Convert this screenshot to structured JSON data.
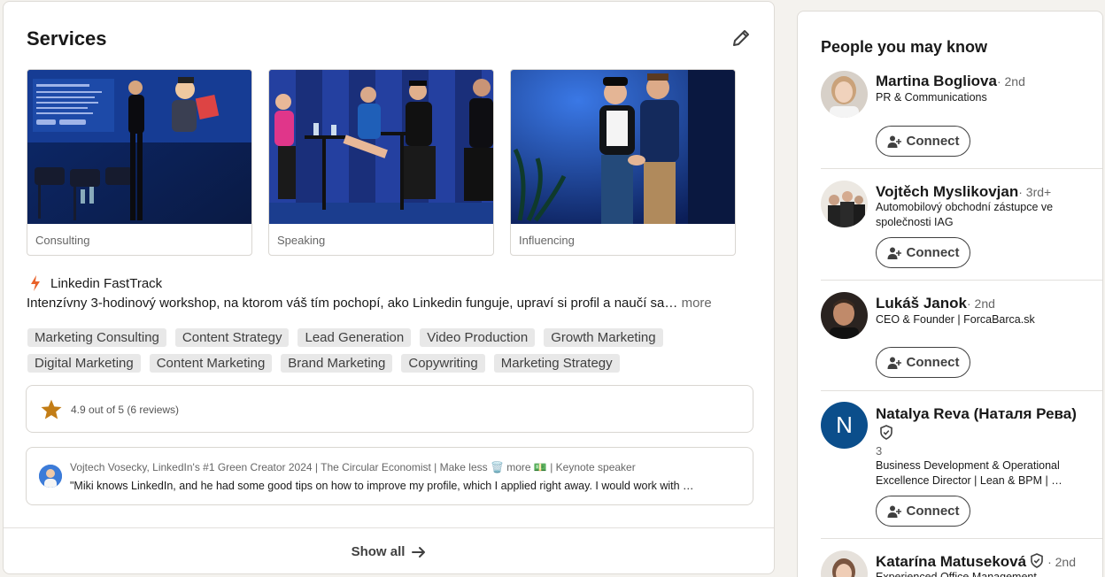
{
  "services": {
    "title": "Services",
    "tiles": [
      {
        "label": "Consulting"
      },
      {
        "label": "Speaking"
      },
      {
        "label": "Influencing"
      }
    ],
    "offer_title": "Linkedin FastTrack",
    "description": "Intenzívny 3-hodinový workshop, na ktorom váš tím pochopí, ako Linkedin funguje, upraví si profil a naučí sa…",
    "more_label": "more",
    "tags": [
      "Marketing Consulting",
      "Content Strategy",
      "Lead Generation",
      "Video Production",
      "Growth Marketing",
      "Digital Marketing",
      "Content Marketing",
      "Brand Marketing",
      "Copywriting",
      "Marketing Strategy"
    ],
    "rating_text": "4.9 out of 5 (6 reviews)",
    "review": {
      "author": "Vojtech Vosecky, LinkedIn's #1 Green Creator 2024 | The Circular Economist | Make less 🗑️ more 💵 | Keynote speaker",
      "quote": "\"Miki knows LinkedIn, and he had some good tips on how to improve my profile, which I applied right away. I would work with …"
    },
    "show_all_label": "Show all"
  },
  "people": {
    "title": "People you may know",
    "connect_label": "Connect",
    "list": [
      {
        "name": "Martina Bogliova",
        "degree": "· 2nd",
        "headline": "PR & Communications"
      },
      {
        "name": "Vojtěch Myslikovjan",
        "degree": "· 3rd+",
        "headline": "Automobilový obchodní zástupce ve společnosti IAG"
      },
      {
        "name": "Lukáš Janok",
        "degree": "· 2nd",
        "headline": "CEO & Founder | ForcaBarca.sk"
      },
      {
        "name": "Natalya Reva (Наталя Рева)",
        "degree": "3",
        "headline": "Business Development & Operational Excellence Director | Lean & BPM | …",
        "initial": "N"
      },
      {
        "name": "Katarína Matuseková",
        "degree": "· 2nd",
        "headline": "Experienced Office Management"
      }
    ]
  },
  "colors": {
    "accent": "#0a66c2",
    "star": "#c37d16",
    "avatar_n": "#0b4e8b",
    "bolt": "#e8622a"
  }
}
